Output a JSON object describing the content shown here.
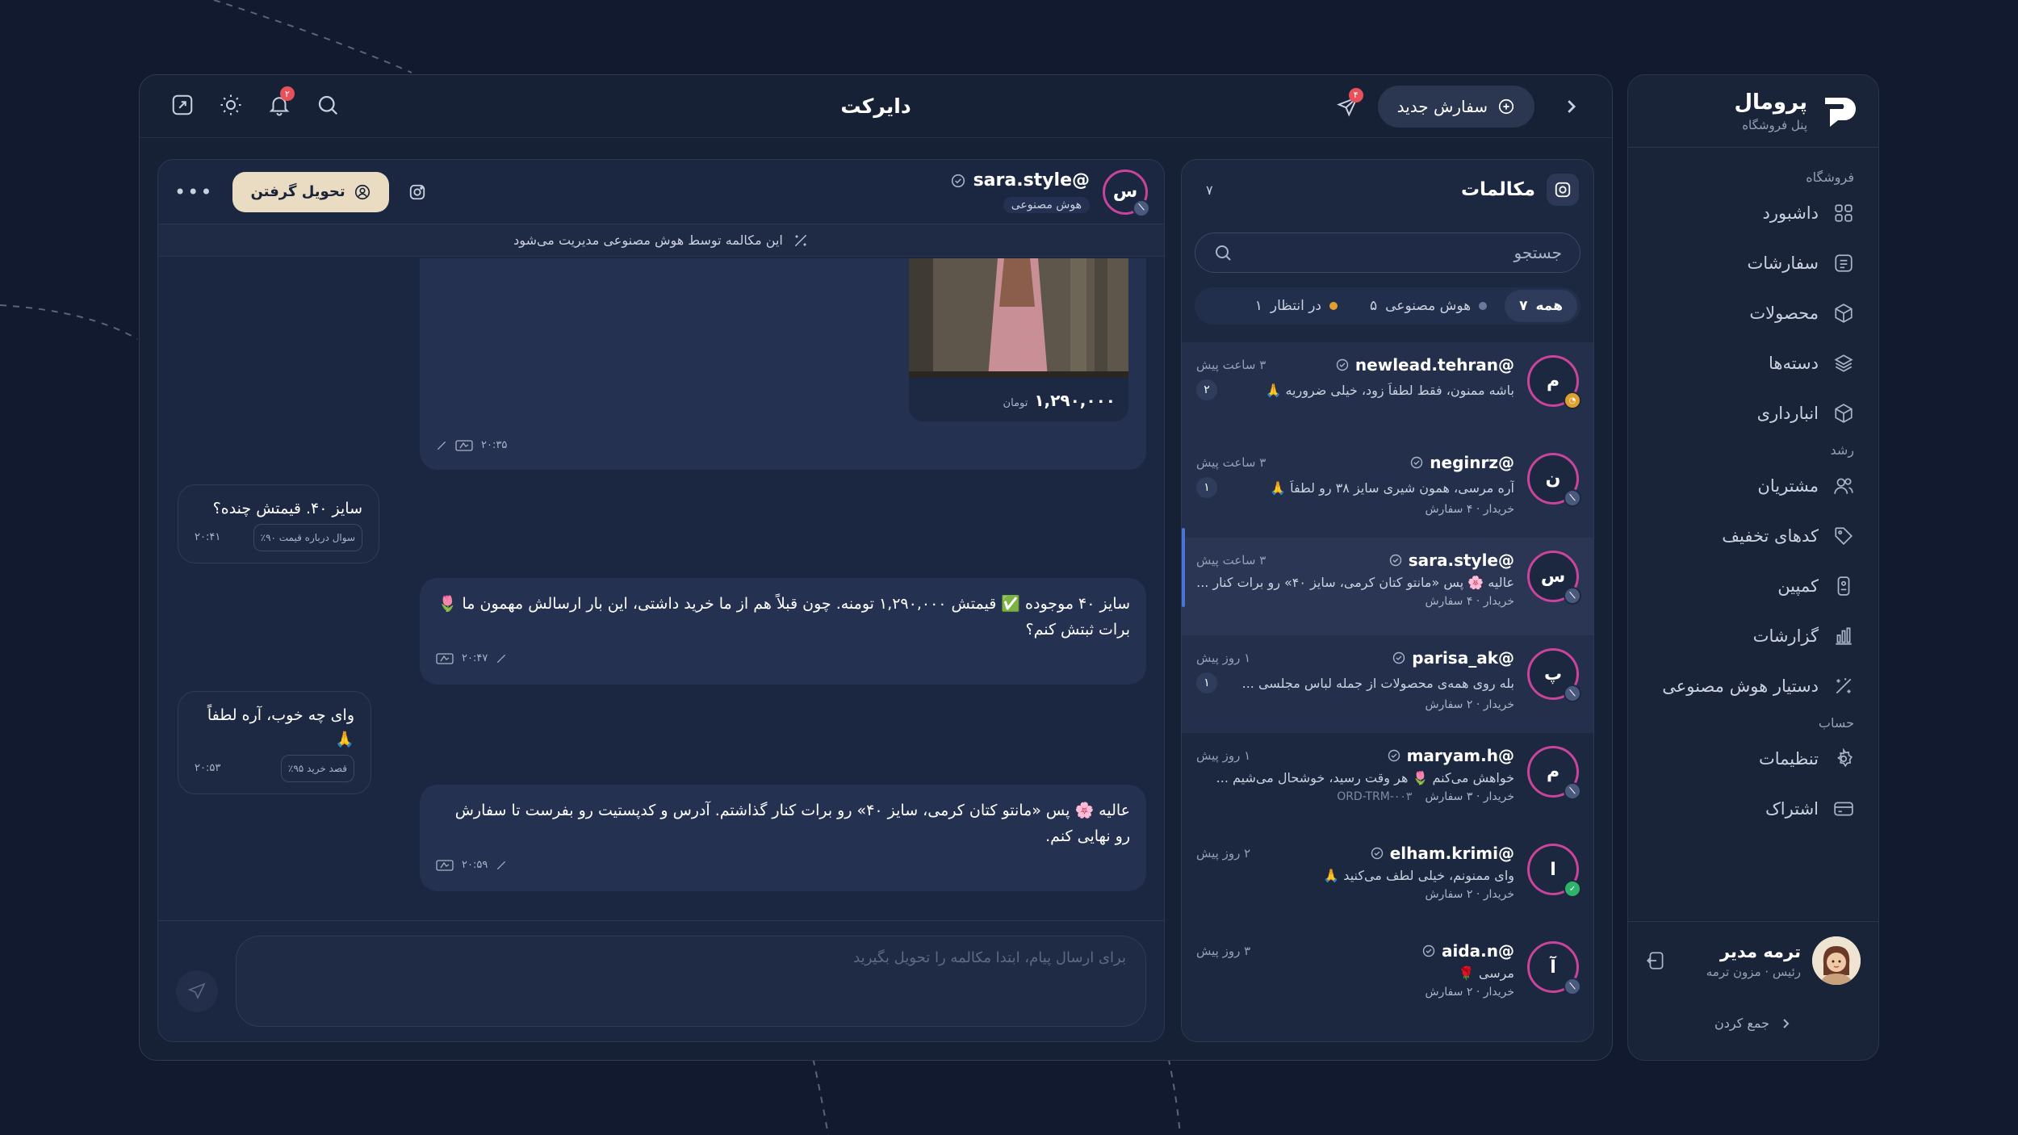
{
  "sidebar": {
    "brand_name": "پرومال",
    "brand_sub": "پنل فروشگاه",
    "sections": [
      {
        "title": "فروشگاه",
        "items": [
          {
            "label": "داشبورد",
            "icon": "grid-icon"
          },
          {
            "label": "سفارشات",
            "icon": "list-icon"
          },
          {
            "label": "محصولات",
            "icon": "box-icon"
          },
          {
            "label": "دسته‌ها",
            "icon": "layers-icon"
          },
          {
            "label": "انبارداری",
            "icon": "cube-icon"
          }
        ]
      },
      {
        "title": "رشد",
        "items": [
          {
            "label": "مشتریان",
            "icon": "users-icon"
          },
          {
            "label": "کدهای تخفیف",
            "icon": "tag-icon"
          },
          {
            "label": "کمپین",
            "icon": "campaign-icon"
          },
          {
            "label": "گزارشات",
            "icon": "bar-chart-icon"
          },
          {
            "label": "دستیار هوش مصنوعی",
            "icon": "sparkle-icon"
          }
        ]
      },
      {
        "title": "حساب",
        "items": [
          {
            "label": "تنظیمات",
            "icon": "gear-icon"
          },
          {
            "label": "اشتراک",
            "icon": "card-icon"
          }
        ]
      }
    ],
    "user_name": "ترمه مدیر",
    "user_role": "رئیس · مزون ترمه",
    "collapse_label": "جمع کردن"
  },
  "topbar": {
    "title": "دایرکت",
    "new_order_label": "سفارش جدید",
    "send_badge": "۴",
    "bell_badge": "۲"
  },
  "conversations": {
    "title": "مکالمات",
    "count": "۷",
    "search_placeholder": "جستجو",
    "filters": [
      {
        "label": "همه",
        "count": "۷",
        "dot": ""
      },
      {
        "label": "هوش مصنوعی",
        "count": "۵",
        "dot": "#6b7a9c"
      },
      {
        "label": "در انتظار",
        "count": "۱",
        "dot": "#e0a030"
      }
    ],
    "items": [
      {
        "initial": "م",
        "name": "newlead.tehran@",
        "time": "۳ ساعت پیش",
        "message": "باشه ممنون، فقط لطفاً زود، خیلی ضروریه 🙏",
        "unread": "۲",
        "meta": "",
        "order": "",
        "badge_color": "#e0a030"
      },
      {
        "initial": "ن",
        "name": "neginrz@",
        "time": "۳ ساعت پیش",
        "message": "آره مرسی، همون شیری سایز ۳۸ رو لطفاً 🙏",
        "unread": "۱",
        "meta": "خریدار · ۴ سفارش",
        "order": "",
        "badge_color": "#4a5a7e"
      },
      {
        "initial": "س",
        "name": "sara.style@",
        "time": "۳ ساعت پیش",
        "message": "عالیه 🌸 پس «مانتو کتان کرمی، سایز ۴۰» رو برات کنار ...",
        "unread": "",
        "meta": "خریدار · ۴ سفارش",
        "order": "",
        "badge_color": "#4a5a7e"
      },
      {
        "initial": "پ",
        "name": "parisa_ak@",
        "time": "۱ روز پیش",
        "message": "بله روی همه‌ی محصولات از جمله لباس مجلسی ...",
        "unread": "۱",
        "meta": "خریدار · ۲ سفارش",
        "order": "",
        "badge_color": "#4a5a7e"
      },
      {
        "initial": "م",
        "name": "maryam.h@",
        "time": "۱ روز پیش",
        "message": "خواهش می‌کنم 🌷 هر وقت رسید، خوشحال می‌شیم ...",
        "unread": "",
        "meta": "خریدار · ۳ سفارش",
        "order": "ORD-TRM-۰۰۳",
        "badge_color": "#4a5a7e"
      },
      {
        "initial": "ا",
        "name": "elham.krimi@",
        "time": "۲ روز پیش",
        "message": "وای ممنونم، خیلی لطف می‌کنید 🙏",
        "unread": "",
        "meta": "خریدار · ۲ سفارش",
        "order": "",
        "badge_color": "#2fb36b"
      },
      {
        "initial": "آ",
        "name": "aida.n@",
        "time": "۳ روز پیش",
        "message": "مرسی 🌹",
        "unread": "",
        "meta": "خریدار · ۲ سفارش",
        "order": "",
        "badge_color": "#4a5a7e"
      }
    ]
  },
  "chat": {
    "initial": "س",
    "name": "sara.style@",
    "tag": "هوش مصنوعی",
    "take_label": "تحویل گرفتن",
    "ai_banner": "این مکالمه توسط هوش مصنوعی مدیریت می‌شود",
    "product_price": "۱,۲۹۰,۰۰۰",
    "product_currency": "تومان",
    "product_time": "۲۰:۳۵",
    "messages": [
      {
        "dir": "in",
        "text": "سایز ۴۰. قیمتش چنده؟",
        "time": "۲۰:۴۱",
        "chip": "سوال درباره قیمت ۹۰٪"
      },
      {
        "dir": "out",
        "text": "سایز ۴۰ موجوده ✅ قیمتش ۱,۲۹۰,۰۰۰ تومنه. چون قبلاً هم از ما خرید داشتی، این بار ارسالش مهمون ما 🌷 برات ثبتش کنم؟",
        "time": "۲۰:۴۷"
      },
      {
        "dir": "in",
        "text": "وای چه خوب، آره لطفاً 🙏",
        "time": "۲۰:۵۳",
        "chip": "قصد خرید ۹۵٪"
      },
      {
        "dir": "out",
        "text": "عالیه 🌸 پس «مانتو کتان کرمی، سایز ۴۰» رو برات کنار گذاشتم. آدرس و کدپستیت رو بفرست تا سفارش رو نهایی کنم.",
        "time": "۲۰:۵۹"
      }
    ],
    "composer_placeholder": "برای ارسال پیام، ابتدا مکالمه را تحویل بگیرید"
  }
}
